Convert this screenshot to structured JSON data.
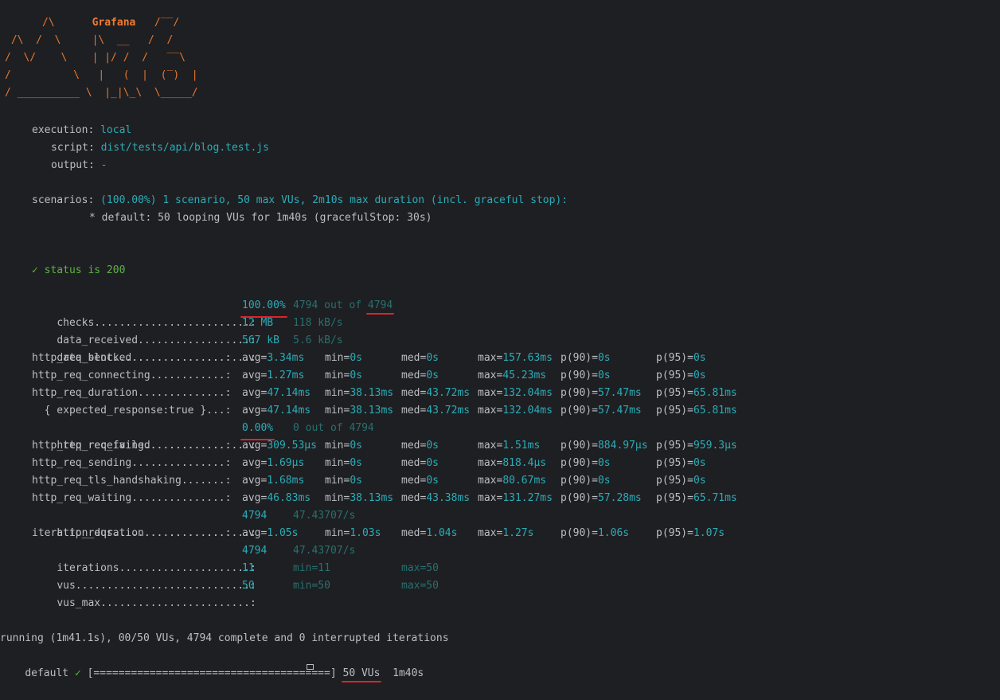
{
  "logo": {
    "art": "      /\\      Grafana   /‾‾/\n /\\  /  \\     |\\  __   /  /\n/  \\/    \\    | |/ /  /   ‾‾\\\n/          \\   |   (  |  (‾)  |\n/ __________ \\  |_|\\_\\  \\_____/",
    "brand": "Grafana"
  },
  "execution": {
    "execution_label": "execution:",
    "execution_value": "local",
    "script_label": "script:",
    "script_value": "dist/tests/api/blog.test.js",
    "output_label": "output:",
    "output_value": "-"
  },
  "scenarios": {
    "label": "scenarios:",
    "summary": "(100.00%) 1 scenario, 50 max VUs, 2m10s max duration (incl. graceful stop):",
    "detail": "* default: 50 looping VUs for 1m40s (gracefulStop: 30s)"
  },
  "check_result": "✓ status is 200",
  "metrics": {
    "checks": {
      "name": "checks.........................:",
      "value": "100.00%",
      "extra": "4794 out of",
      "extra2": "4794"
    },
    "data_received": {
      "name": "data_received..................:",
      "value": "12 MB",
      "rate": "118 kB/s"
    },
    "data_sent": {
      "name": "data_sent......................:",
      "value": "567 kB",
      "rate": "5.6 kB/s"
    },
    "http_req_failed": {
      "name": "http_req_failed................:",
      "value": "0.00%",
      "extra": "0 out of 4794"
    },
    "http_reqs": {
      "name": "http_reqs......................:",
      "value": "4794",
      "rate": "47.43707/s"
    },
    "iterations": {
      "name": "iterations.....................:",
      "value": "4794",
      "rate": "47.43707/s"
    },
    "vus": {
      "name": "vus............................:",
      "value": "11",
      "min": "min=11",
      "max": "max=50"
    },
    "vus_max": {
      "name": "vus_max........................:",
      "value": "50",
      "min": "min=50",
      "max": "max=50"
    }
  },
  "trend_rows": [
    {
      "name": "http_req_blocked...............:",
      "avg_l": "avg=",
      "avg": "3.34ms",
      "min_l": "min=",
      "min": "0s",
      "med_l": "med=",
      "med": "0s",
      "max_l": "max=",
      "max": "157.63ms",
      "p90_l": "p(90)=",
      "p90": "0s",
      "p95_l": "p(95)=",
      "p95": "0s"
    },
    {
      "name": "http_req_connecting............:",
      "avg_l": "avg=",
      "avg": "1.27ms",
      "min_l": "min=",
      "min": "0s",
      "med_l": "med=",
      "med": "0s",
      "max_l": "max=",
      "max": "45.23ms",
      "p90_l": "p(90)=",
      "p90": "0s",
      "p95_l": "p(95)=",
      "p95": "0s"
    },
    {
      "name": "http_req_duration..............:",
      "avg_l": "avg=",
      "avg": "47.14ms",
      "min_l": "min=",
      "min": "38.13ms",
      "med_l": "med=",
      "med": "43.72ms",
      "max_l": "max=",
      "max": "132.04ms",
      "p90_l": "p(90)=",
      "p90": "57.47ms",
      "p95_l": "p(95)=",
      "p95": "65.81ms"
    },
    {
      "name": "  { expected_response:true }...:",
      "avg_l": "avg=",
      "avg": "47.14ms",
      "min_l": "min=",
      "min": "38.13ms",
      "med_l": "med=",
      "med": "43.72ms",
      "max_l": "max=",
      "max": "132.04ms",
      "p90_l": "p(90)=",
      "p90": "57.47ms",
      "p95_l": "p(95)=",
      "p95": "65.81ms"
    },
    {
      "name": "http_req_receiving.............:",
      "avg_l": "avg=",
      "avg": "309.53µs",
      "min_l": "min=",
      "min": "0s",
      "med_l": "med=",
      "med": "0s",
      "max_l": "max=",
      "max": "1.51ms",
      "p90_l": "p(90)=",
      "p90": "884.97µs",
      "p95_l": "p(95)=",
      "p95": "959.3µs"
    },
    {
      "name": "http_req_sending...............:",
      "avg_l": "avg=",
      "avg": "1.69µs",
      "min_l": "min=",
      "min": "0s",
      "med_l": "med=",
      "med": "0s",
      "max_l": "max=",
      "max": "818.4µs",
      "p90_l": "p(90)=",
      "p90": "0s",
      "p95_l": "p(95)=",
      "p95": "0s"
    },
    {
      "name": "http_req_tls_handshaking.......:",
      "avg_l": "avg=",
      "avg": "1.68ms",
      "min_l": "min=",
      "min": "0s",
      "med_l": "med=",
      "med": "0s",
      "max_l": "max=",
      "max": "80.67ms",
      "p90_l": "p(90)=",
      "p90": "0s",
      "p95_l": "p(95)=",
      "p95": "0s"
    },
    {
      "name": "http_req_waiting...............:",
      "avg_l": "avg=",
      "avg": "46.83ms",
      "min_l": "min=",
      "min": "38.13ms",
      "med_l": "med=",
      "med": "43.38ms",
      "max_l": "max=",
      "max": "131.27ms",
      "p90_l": "p(90)=",
      "p90": "57.28ms",
      "p95_l": "p(95)=",
      "p95": "65.71ms"
    },
    {
      "name": "iteration_duration.............:",
      "avg_l": "avg=",
      "avg": "1.05s",
      "min_l": "min=",
      "min": "1.03s",
      "med_l": "med=",
      "med": "1.04s",
      "max_l": "max=",
      "max": "1.27s",
      "p90_l": "p(90)=",
      "p90": "1.06s",
      "p95_l": "p(95)=",
      "p95": "1.07s"
    }
  ],
  "footer": {
    "running": "running (1m41.1s), 00/50 VUs, 4794 complete and 0 interrupted iterations",
    "default_label": "default",
    "check_mark": "✓",
    "progress_bar": "[======================================]",
    "vus": "50 VUs",
    "duration": "1m40s"
  },
  "colors": {
    "background": "#1e1f22",
    "text": "#bcbec4",
    "value": "#2aacb8",
    "dim": "#28706f",
    "logo": "#e8772e",
    "ok": "#5fb346",
    "annotation": "#e0222a"
  }
}
